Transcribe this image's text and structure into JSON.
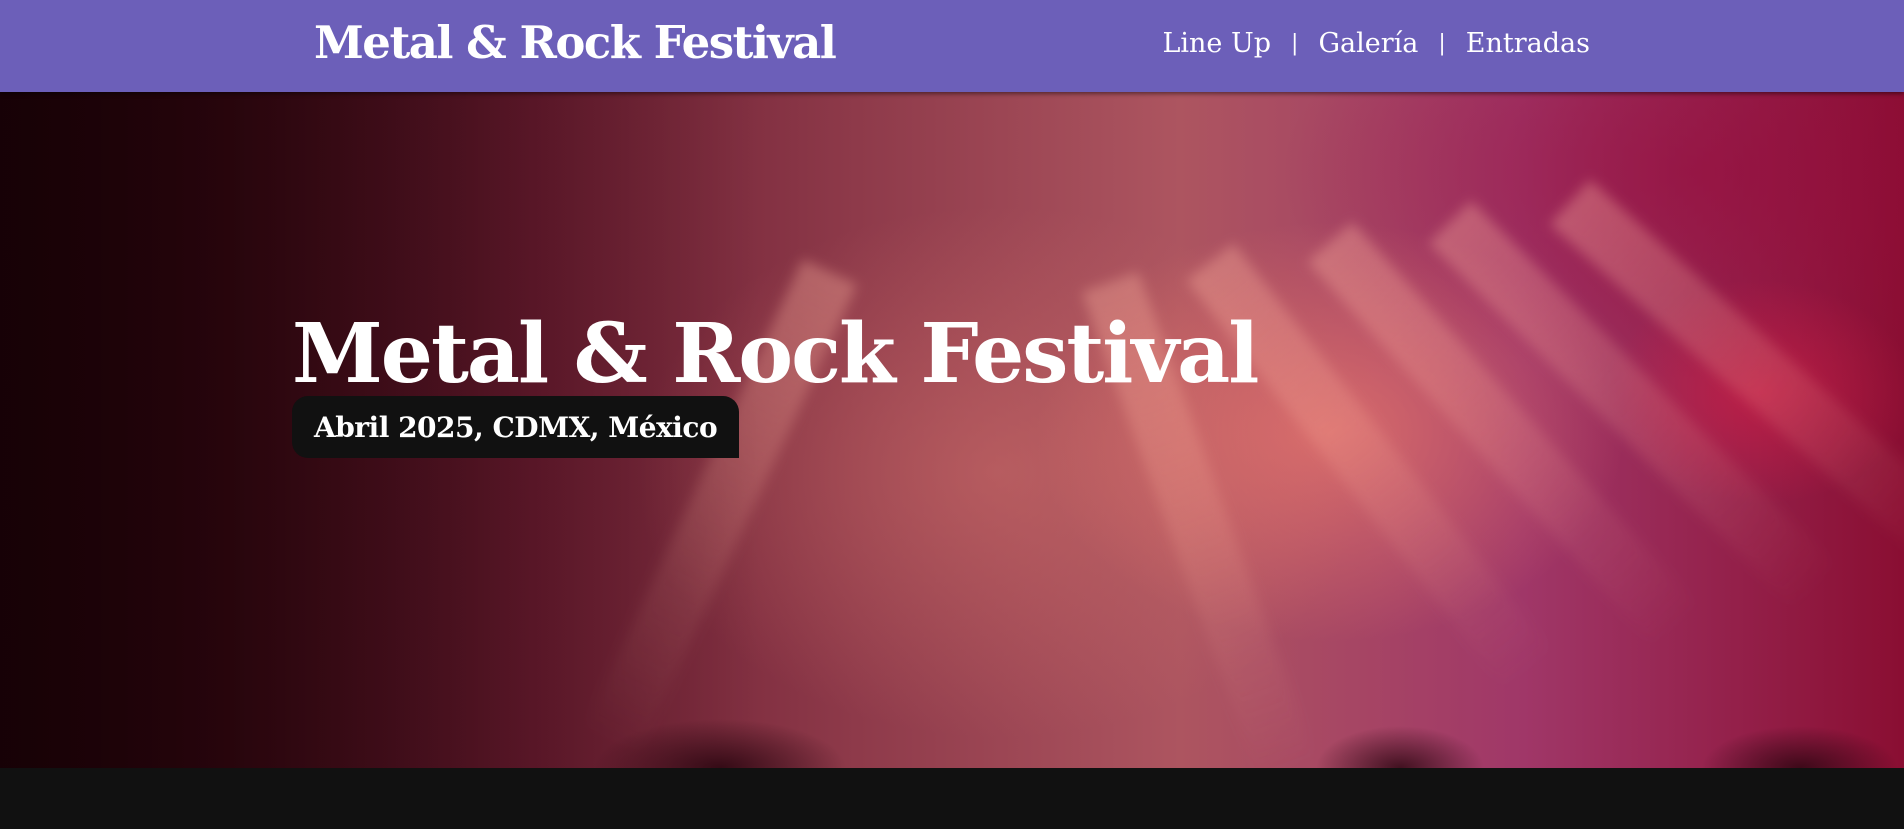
{
  "header": {
    "brand": "Metal & Rock Festival",
    "nav": [
      {
        "label": "Line Up"
      },
      {
        "label": "Galería"
      },
      {
        "label": "Entradas"
      }
    ],
    "separator": "|",
    "background_color": "#6c5fb9"
  },
  "hero": {
    "title": "Metal & Rock Festival",
    "subtitle": "Abril 2025, CDMX, México",
    "badge_color": "#111111"
  },
  "colors": {
    "accent": "#6c5fb9",
    "text": "#ffffff",
    "page_background": "#111111"
  }
}
